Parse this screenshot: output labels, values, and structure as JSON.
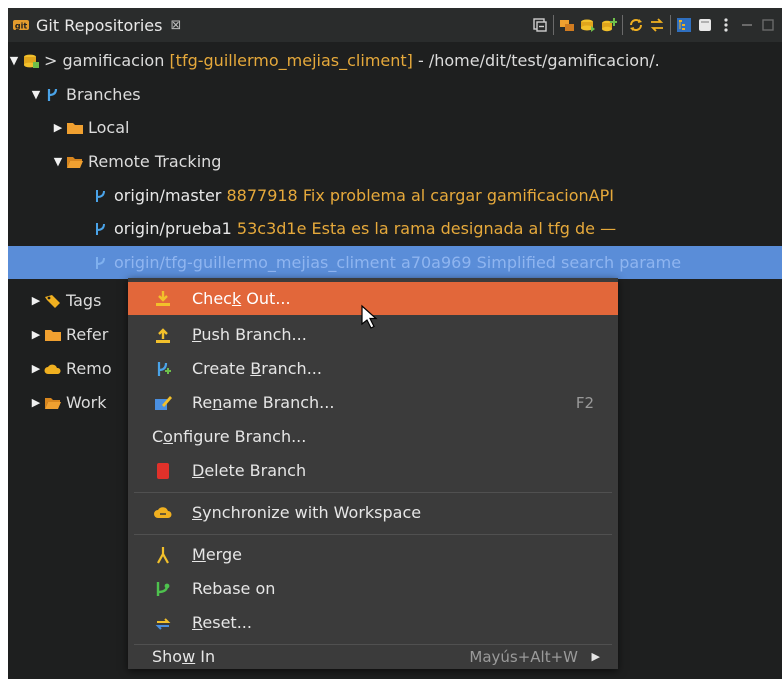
{
  "view": {
    "title": "Git Repositories",
    "close_glyph": "⊠",
    "toolbar_icons": [
      "collapse-all-icon",
      "link-with-selection-icon",
      "clone-repository-icon",
      "add-repository-icon",
      "create-repository-icon",
      "refresh-icon",
      "sync-icon",
      "tree-layout-icon",
      "filter-icon",
      "view-menu-icon",
      "minimize-icon",
      "maximize-icon"
    ]
  },
  "tree": {
    "repository": {
      "name": "gamificacion",
      "prefix": ">",
      "branch": "[tfg-guillermo_mejias_climent]",
      "path": "- /home/dit/test/gamificacion/."
    },
    "branches_label": "Branches",
    "local_label": "Local",
    "remote_tracking_label": "Remote Tracking",
    "remote_branches": [
      {
        "name": "origin/master",
        "sha": "8877918",
        "message": "Fix problema al cargar gamificacionAPI"
      },
      {
        "name": "origin/prueba1",
        "sha": "53c3d1e",
        "message": "Esta es la rama designada al tfg de —"
      },
      {
        "name": "origin/tfg-guillermo_mejias_climent",
        "sha": "a70a969",
        "message": "Simplified search parame"
      }
    ],
    "tags_label": "Tags",
    "references_label": "Refer",
    "remotes_label": "Remo",
    "working_tree_label": "Work"
  },
  "context_menu": {
    "check_out": {
      "before": "Chec",
      "mnemonic": "k",
      "after": " Out..."
    },
    "push_branch": {
      "before": "",
      "mnemonic": "P",
      "after": "ush Branch..."
    },
    "create_branch": {
      "before": "Create ",
      "mnemonic": "B",
      "after": "ranch..."
    },
    "rename_branch": {
      "before": "Re",
      "mnemonic": "n",
      "after": "ame Branch...",
      "shortcut": "F2"
    },
    "configure_branch": {
      "before": "C",
      "mnemonic": "o",
      "after": "nfigure Branch..."
    },
    "delete_branch": {
      "before": "",
      "mnemonic": "D",
      "after": "elete Branch"
    },
    "synchronize": {
      "before": "",
      "mnemonic": "S",
      "after": "ynchronize with Workspace"
    },
    "merge": {
      "before": "",
      "mnemonic": "M",
      "after": "erge"
    },
    "rebase": {
      "before": "Rebase on",
      "mnemonic": "",
      "after": ""
    },
    "reset": {
      "before": "",
      "mnemonic": "R",
      "after": "eset..."
    },
    "show_in": {
      "before": "Sho",
      "mnemonic": "w",
      "after": " In",
      "shortcut": "Mayús+Alt+W"
    }
  },
  "colors": {
    "accent": "#e2673a",
    "selection": "#5a8dd8",
    "sha": "#e6a93b",
    "folder": "#f0a030"
  }
}
